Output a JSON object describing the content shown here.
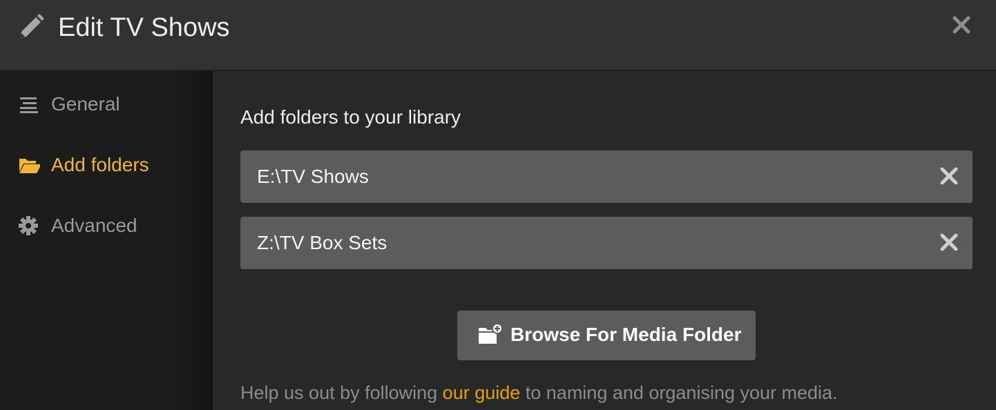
{
  "header": {
    "title": "Edit TV Shows",
    "icon": "pencil-icon",
    "close_icon": "close-icon"
  },
  "sidebar": {
    "items": [
      {
        "label": "General",
        "icon": "list-icon",
        "active": false
      },
      {
        "label": "Add folders",
        "icon": "folder-open-icon",
        "active": true
      },
      {
        "label": "Advanced",
        "icon": "gear-icon",
        "active": false
      }
    ]
  },
  "main": {
    "section_title": "Add folders to your library",
    "folders": [
      {
        "path": "E:\\TV Shows"
      },
      {
        "path": "Z:\\TV Box Sets"
      }
    ],
    "browse_button_label": "Browse For Media Folder",
    "help": {
      "prefix": "Help us out by following ",
      "link_text": "our guide",
      "suffix": " to naming and organising your media."
    }
  },
  "colors": {
    "accent": "#f0b63c",
    "link": "#e5a00d",
    "header_bg": "#323232",
    "sidebar_bg": "#1c1c1c",
    "main_bg": "#282828",
    "row_bg": "#5c5c5c"
  }
}
